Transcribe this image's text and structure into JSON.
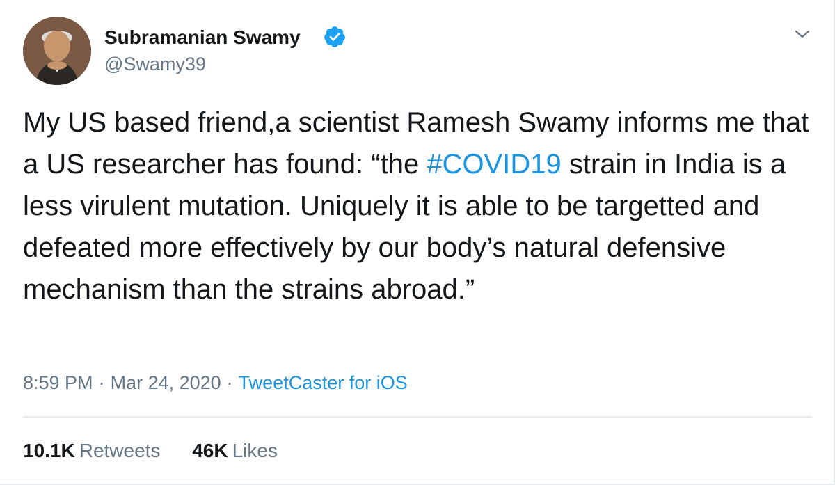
{
  "author": {
    "display_name": "Subramanian Swamy",
    "handle": "@Swamy39",
    "verified": true,
    "avatar_icon": "profile-photo"
  },
  "tweet": {
    "text_before": "My US based friend,a scientist Ramesh Swamy informs me that a US researcher has found: “the ",
    "hashtag": "#COVID19",
    "text_after": " strain in India is a less virulent mutation. Uniquely it is able to be targetted and defeated more effectively by our body’s natural defensive mechanism than the strains abroad.”"
  },
  "meta": {
    "time": "8:59 PM",
    "separator": "·",
    "date": "Mar 24, 2020",
    "source": "TweetCaster for iOS"
  },
  "stats": {
    "retweets_count": "10.1K",
    "retweets_label": "Retweets",
    "likes_count": "46K",
    "likes_label": "Likes"
  },
  "colors": {
    "text": "#14171a",
    "secondary": "#657786",
    "link": "#1b95e0",
    "verified": "#1da1f2",
    "divider": "#e6ecf0"
  },
  "icons": [
    "verified-badge-icon",
    "chevron-down-icon"
  ]
}
